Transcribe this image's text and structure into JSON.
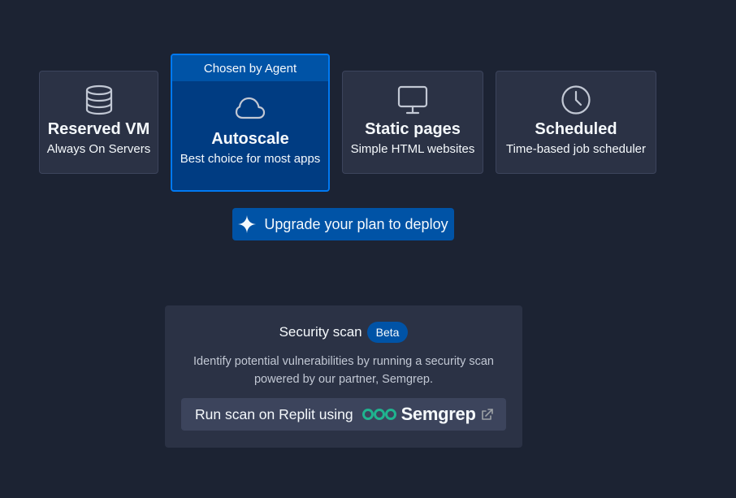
{
  "deploy_options": {
    "reserved_vm": {
      "title": "Reserved VM",
      "subtitle": "Always On Servers",
      "icon": "database-icon"
    },
    "autoscale": {
      "badge": "Chosen by Agent",
      "title": "Autoscale",
      "subtitle": "Best choice for most apps",
      "icon": "cloud-icon",
      "selected": true
    },
    "static_pages": {
      "title": "Static pages",
      "subtitle": "Simple HTML websites",
      "icon": "monitor-icon"
    },
    "scheduled": {
      "title": "Scheduled",
      "subtitle": "Time-based job scheduler",
      "icon": "clock-icon"
    }
  },
  "upgrade_button": {
    "label": "Upgrade your plan to deploy",
    "icon": "sparkle-icon"
  },
  "security_scan": {
    "title": "Security scan",
    "badge": "Beta",
    "description": "Identify potential vulnerabilities by running a security scan powered by our partner, Semgrep.",
    "button_label": "Run scan on Replit using",
    "partner_name": "Semgrep",
    "partner_icon": "semgrep-logo-icon",
    "external_icon": "external-link-icon"
  },
  "colors": {
    "background": "#1c2333",
    "card": "#2b3245",
    "selected_card": "#003c82",
    "selected_border": "#0079f2",
    "accent_blue": "#0053a6",
    "semgrep_green": "#1fb48f"
  }
}
